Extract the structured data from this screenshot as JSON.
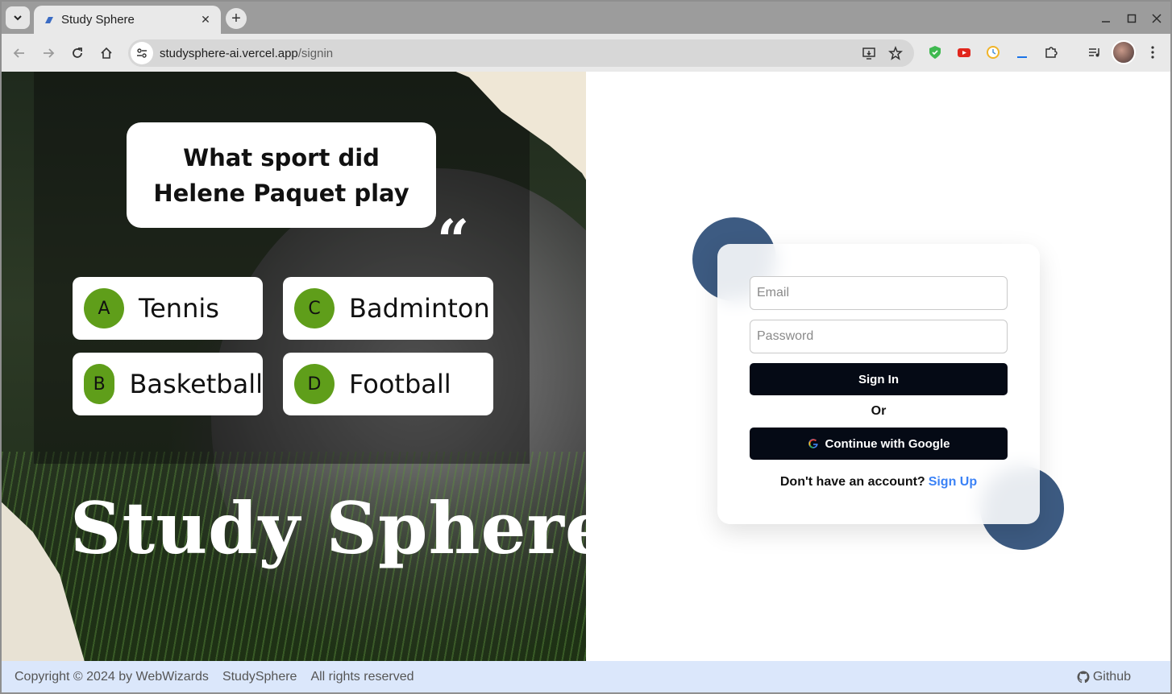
{
  "browser": {
    "tab_title": "Study Sphere",
    "url_domain": "studysphere-ai.vercel.app",
    "url_path": "/signin"
  },
  "hero": {
    "question": "What sport did Helene Paquet play",
    "options": [
      {
        "letter": "A",
        "label": "Tennis"
      },
      {
        "letter": "B",
        "label": "Basketball"
      },
      {
        "letter": "C",
        "label": "Badminton"
      },
      {
        "letter": "D",
        "label": "Football"
      }
    ],
    "brand": "Study Sphere",
    "quote_glyph": "“"
  },
  "signin": {
    "email_placeholder": "Email",
    "password_placeholder": "Password",
    "signin_label": "Sign In",
    "or_label": "Or",
    "google_label": "Continue with Google",
    "no_account_text": "Don't have an account?",
    "signup_link": "Sign Up"
  },
  "footer": {
    "copyright": "Copyright © 2024 by WebWizards",
    "brand": "StudySphere",
    "rights": "All rights reserved",
    "github": "Github"
  },
  "colors": {
    "accent_blue": "#3d5b82",
    "button_dark": "#050a15",
    "option_green": "#5f9e1a",
    "footer_bg": "#dbe7fb",
    "link_blue": "#3b82f6"
  },
  "icons": [
    "tab-search-icon",
    "chrome-tab-favicon",
    "close-icon",
    "plus-icon",
    "minimize-icon",
    "maximize-icon",
    "window-close-icon",
    "back-icon",
    "forward-icon",
    "reload-icon",
    "home-icon",
    "site-settings-icon",
    "install-icon",
    "star-icon",
    "shield-extension-icon",
    "youtube-extension-icon",
    "clock-extension-icon",
    "puzzle-icon",
    "media-icon",
    "kebab-menu-icon",
    "google-icon",
    "github-icon"
  ]
}
